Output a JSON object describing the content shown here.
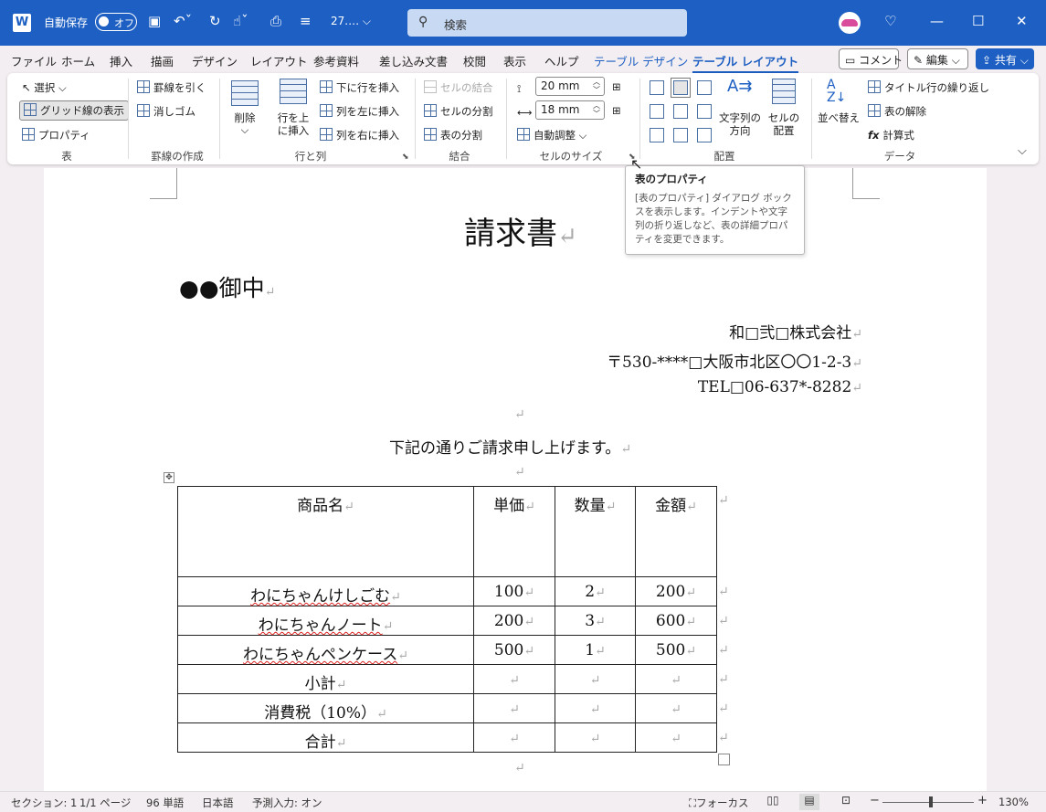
{
  "titlebar": {
    "autosave_label": "自動保存",
    "toggle_text": "オフ",
    "doc_name": "27.… ⌵",
    "search_placeholder": "検索"
  },
  "tabs": [
    "ファイル",
    "ホーム",
    "挿入",
    "描画",
    "デザイン",
    "レイアウト",
    "参考資料",
    "差し込み文書",
    "校閲",
    "表示",
    "ヘルプ",
    "テーブル デザイン",
    "テーブル レイアウト"
  ],
  "tab_buttons": {
    "comment": "コメント",
    "edit": "編集 ⌵",
    "share": "共有 ⌵"
  },
  "ribbon": {
    "table": {
      "select": "選択 ⌵",
      "gridlines": "グリッド線の表示",
      "properties": "プロパティ",
      "label": "表"
    },
    "draw": {
      "draw_border": "罫線を引く",
      "eraser": "消しゴム",
      "label": "罫線の作成"
    },
    "rows_cols": {
      "delete": "削除",
      "delete_arrow": "⌵",
      "insert_above": "行を上\nに挿入",
      "insert_below": "下に行を挿入",
      "insert_left": "列を左に挿入",
      "insert_right": "列を右に挿入",
      "label": "行と列"
    },
    "merge": {
      "merge_cells": "セルの結合",
      "split_cells": "セルの分割",
      "split_table": "表の分割",
      "label": "結合"
    },
    "cell_size": {
      "height": "20 mm",
      "width": "18 mm",
      "autofit": "自動調整 ⌵",
      "label": "セルのサイズ"
    },
    "alignment": {
      "text_direction": "文字列の\n方向",
      "cell_margins": "セルの\n配置",
      "label": "配置"
    },
    "data": {
      "sort": "並べ替え",
      "repeat_header": "タイトル行の繰り返し",
      "convert": "表の解除",
      "formula": "計算式",
      "label": "データ"
    }
  },
  "tooltip": {
    "title": "表のプロパティ",
    "body": "[表のプロパティ] ダイアログ ボックスを表示します。インデントや文字列の折り返しなど、表の詳細プロパティを変更できます。"
  },
  "document": {
    "title": "請求書",
    "recipient": "●●御中",
    "sender": [
      "和□弐□株式会社",
      "〒530-****□大阪市北区〇〇1-2-3",
      "TEL□06-637*-8282"
    ],
    "intro": "下記の通りご請求申し上げます。",
    "para_mark": "↵",
    "table": {
      "headers": [
        "商品名",
        "単価",
        "数量",
        "金額"
      ],
      "rows": [
        [
          "わにちゃんけしごむ",
          "100",
          "2",
          "200"
        ],
        [
          "わにちゃんノート",
          "200",
          "3",
          "600"
        ],
        [
          "わにちゃんペンケース",
          "500",
          "1",
          "500"
        ],
        [
          "小計",
          "",
          "",
          ""
        ],
        [
          "消費税（10%）",
          "",
          "",
          ""
        ],
        [
          "合計",
          "",
          "",
          ""
        ]
      ]
    }
  },
  "statusbar": {
    "section": "セクション: 1",
    "page": "1/1 ページ",
    "words": "96 単語",
    "language": "日本語",
    "predict": "予測入力: オン",
    "focus": "フォーカス",
    "zoom": "130%",
    "zoom_minus": "−",
    "zoom_plus": "+"
  }
}
